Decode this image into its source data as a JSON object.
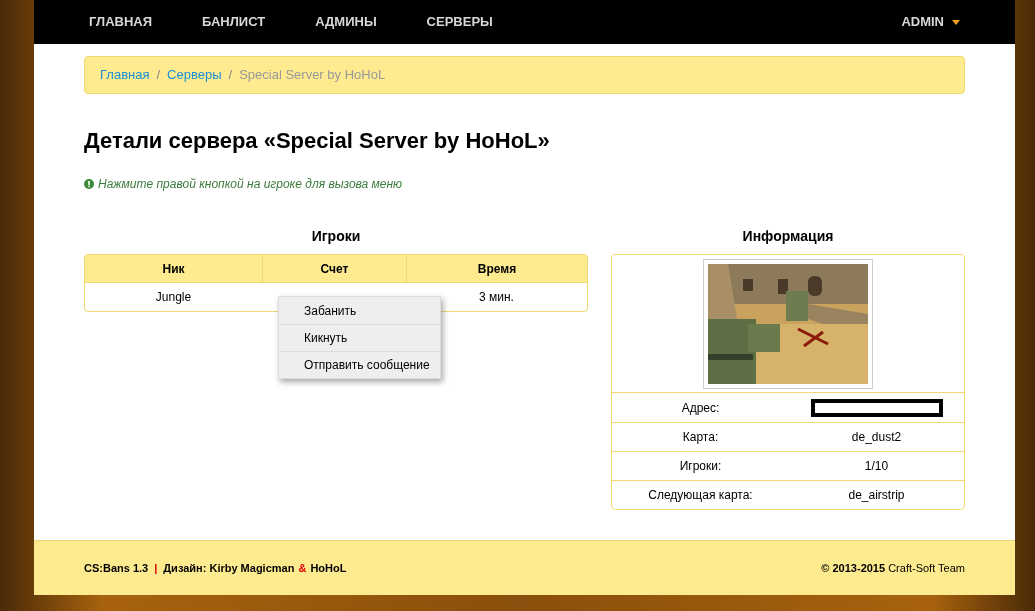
{
  "navbar": {
    "items": [
      {
        "label": "ГЛАВНАЯ"
      },
      {
        "label": "БАНЛИСТ"
      },
      {
        "label": "АДМИНЫ"
      },
      {
        "label": "СЕРВЕРЫ"
      }
    ],
    "user_menu": {
      "label": "ADMIN",
      "expanded": false
    }
  },
  "breadcrumb": [
    {
      "label": "Главная",
      "kind": "link"
    },
    {
      "label": "/",
      "kind": "separator"
    },
    {
      "label": "Серверы",
      "kind": "link"
    },
    {
      "label": "/",
      "kind": "separator"
    },
    {
      "label": "Special Server by HoHoL",
      "kind": "current"
    }
  ],
  "title": "Детали сервера «Special Server by HoHoL»",
  "hint": "Нажмите правой кнопкой на игроке для вызова меню",
  "players": {
    "heading": "Игроки",
    "columns": [
      "Ник",
      "Счет",
      "Время"
    ],
    "rows": [
      {
        "nick": "Jungle",
        "time": "3 мин."
      }
    ]
  },
  "context_menu": [
    "Забанить",
    "Кикнуть",
    "Отправить сообщение"
  ],
  "info": {
    "heading": "Информация",
    "rows": [
      {
        "label": "Адрес:",
        "kind": "redacted"
      },
      {
        "label": "Карта:",
        "value": "de_dust2",
        "kind": "text"
      },
      {
        "label": "Игроки:",
        "value": "1/10",
        "kind": "text"
      },
      {
        "label": "Следующая карта:",
        "value": "de_airstrip",
        "kind": "text"
      }
    ]
  },
  "footer": {
    "version": "CS:Bans 1.3",
    "separator": "|",
    "design": "Дизайн: Kirby Magicman",
    "amp": "&",
    "author": "HoHoL",
    "copyright": "**© 2013-2015** Craft-Soft Team"
  }
}
